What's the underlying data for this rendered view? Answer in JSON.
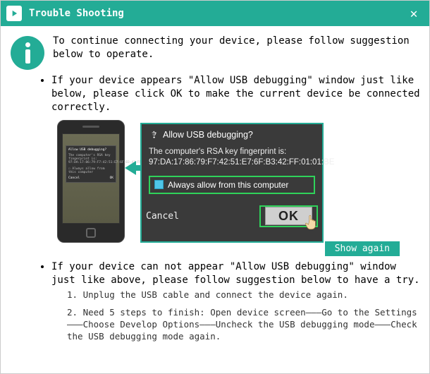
{
  "titlebar": {
    "title": "Trouble Shooting"
  },
  "intro": "To continue connecting your device, please follow suggestion below to operate.",
  "bullet1": "If your device appears \"Allow USB debugging\" window just like below, please click OK to make the current device  be connected correctly.",
  "bullet2": "If your device can not appear \"Allow USB debugging\" window just like above, please follow suggestion below to have a try.",
  "popup": {
    "title": "Allow USB debugging?",
    "fp_label": "The computer's RSA key fingerprint is:",
    "fp_value": "97:DA:17:86:79:F7:42:51:E7:6F:B3:42:FF:01:01:BE",
    "always": "Always allow from this computer",
    "cancel": "Cancel",
    "ok": "OK"
  },
  "phone": {
    "title": "Allow USB debugging?",
    "fp": "The computer's RSA key fingerprint is:\n97:DA:17:86:79:F7:42:51:E7:6F:B3:42:FF:01:01:BE",
    "always": "Always allow from this computer",
    "cancel": "Cancel",
    "ok": "OK"
  },
  "show_again": "Show again",
  "steps": {
    "s1": "1. Unplug the USB cable and connect the device again.",
    "s2": "2. Need 5 steps to finish: Open device screen———Go to the Settings———Choose Develop Options———Uncheck the USB debugging mode———Check the USB debugging mode again."
  }
}
